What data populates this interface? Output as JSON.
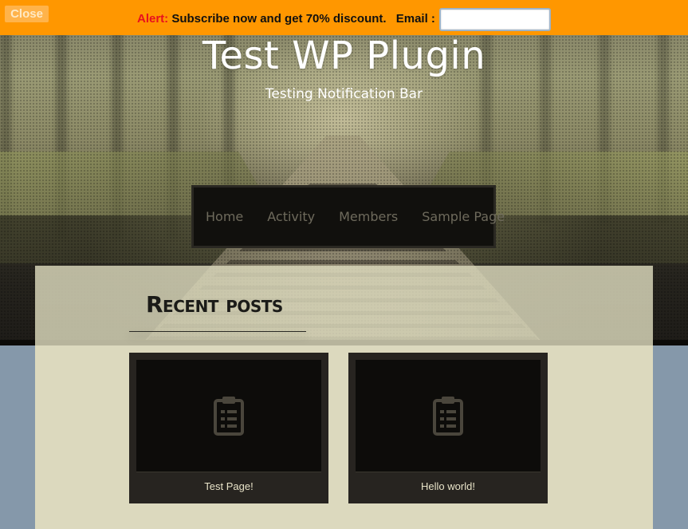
{
  "notification": {
    "close_label": "Close",
    "alert_label": "Alert:",
    "message": "Subscribe now and get 70% discount.",
    "email_label": "Email :",
    "email_value": "",
    "colors": {
      "bar": "#ff9700",
      "alert": "#e8101e"
    }
  },
  "site": {
    "title": "Test WP Plugin",
    "tagline": "Testing Notification Bar"
  },
  "nav": {
    "items": [
      {
        "label": "Home"
      },
      {
        "label": "Activity"
      },
      {
        "label": "Members"
      },
      {
        "label": "Sample Page"
      }
    ]
  },
  "recent": {
    "heading": "Recent posts",
    "posts": [
      {
        "title": "Test Page!",
        "icon": "clipboard-icon"
      },
      {
        "title": "Hello world!",
        "icon": "clipboard-icon"
      }
    ]
  }
}
